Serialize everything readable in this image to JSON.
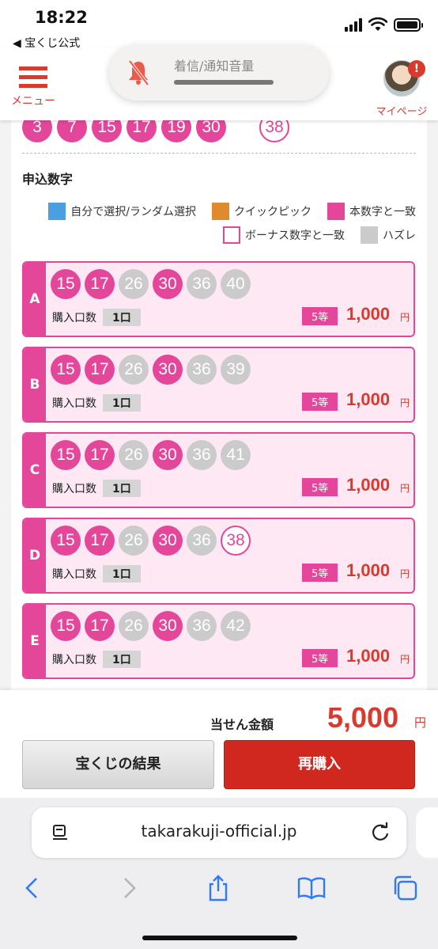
{
  "status": {
    "time": "18:22",
    "back_label": "◀ 宝くじ公式"
  },
  "header": {
    "menu_label": "メニュー",
    "mypage_label": "マイページ",
    "badge": "!"
  },
  "volume": {
    "label": "着信/通知音量"
  },
  "prev_draw": {
    "main": [
      "3",
      "7",
      "15",
      "17",
      "19",
      "30"
    ],
    "bonus": "38"
  },
  "section_title": "申込数字",
  "legend": [
    {
      "label": "自分で選択/ランダム選択",
      "color": "#4a9fe0"
    },
    {
      "label": "クイックピック",
      "color": "#e08a2e"
    },
    {
      "label": "本数字と一致",
      "color": "#e4479a"
    },
    {
      "label": "ボーナス数字と一致",
      "color": "#ffffff"
    },
    {
      "label": "ハズレ",
      "color": "#cbcbcb"
    }
  ],
  "entries": [
    {
      "letter": "A",
      "numbers": [
        {
          "n": "15",
          "s": "hit"
        },
        {
          "n": "17",
          "s": "hit"
        },
        {
          "n": "26",
          "s": "miss"
        },
        {
          "n": "30",
          "s": "hit"
        },
        {
          "n": "36",
          "s": "miss"
        },
        {
          "n": "40",
          "s": "miss"
        }
      ],
      "qty_label": "購入口数",
      "qty": "1口",
      "rank": "5等",
      "amount": "1,000",
      "yen": "円"
    },
    {
      "letter": "B",
      "numbers": [
        {
          "n": "15",
          "s": "hit"
        },
        {
          "n": "17",
          "s": "hit"
        },
        {
          "n": "26",
          "s": "miss"
        },
        {
          "n": "30",
          "s": "hit"
        },
        {
          "n": "36",
          "s": "miss"
        },
        {
          "n": "39",
          "s": "miss"
        }
      ],
      "qty_label": "購入口数",
      "qty": "1口",
      "rank": "5等",
      "amount": "1,000",
      "yen": "円"
    },
    {
      "letter": "C",
      "numbers": [
        {
          "n": "15",
          "s": "hit"
        },
        {
          "n": "17",
          "s": "hit"
        },
        {
          "n": "26",
          "s": "miss"
        },
        {
          "n": "30",
          "s": "hit"
        },
        {
          "n": "36",
          "s": "miss"
        },
        {
          "n": "41",
          "s": "miss"
        }
      ],
      "qty_label": "購入口数",
      "qty": "1口",
      "rank": "5等",
      "amount": "1,000",
      "yen": "円"
    },
    {
      "letter": "D",
      "numbers": [
        {
          "n": "15",
          "s": "hit"
        },
        {
          "n": "17",
          "s": "hit"
        },
        {
          "n": "26",
          "s": "miss"
        },
        {
          "n": "30",
          "s": "hit"
        },
        {
          "n": "36",
          "s": "miss"
        },
        {
          "n": "38",
          "s": "bonus"
        }
      ],
      "qty_label": "購入口数",
      "qty": "1口",
      "rank": "5等",
      "amount": "1,000",
      "yen": "円"
    },
    {
      "letter": "E",
      "numbers": [
        {
          "n": "15",
          "s": "hit"
        },
        {
          "n": "17",
          "s": "hit"
        },
        {
          "n": "26",
          "s": "miss"
        },
        {
          "n": "30",
          "s": "hit"
        },
        {
          "n": "36",
          "s": "miss"
        },
        {
          "n": "42",
          "s": "miss"
        }
      ],
      "qty_label": "購入口数",
      "qty": "1口",
      "rank": "5等",
      "amount": "1,000",
      "yen": "円"
    }
  ],
  "total": {
    "label": "当せん金額",
    "value": "5,000",
    "yen": "円"
  },
  "buttons": {
    "results": "宝くじの結果",
    "rebuy": "再購入"
  },
  "browser": {
    "url": "takarakuji-official.jp"
  },
  "colors": {
    "accent_red": "#d83a2e",
    "hit_pink": "#e4479a",
    "miss_gray": "#cbcbcb"
  }
}
